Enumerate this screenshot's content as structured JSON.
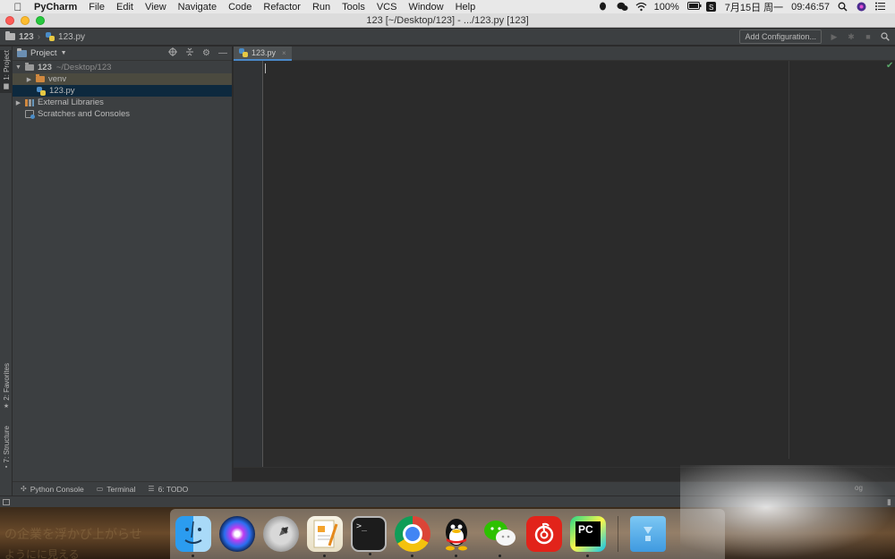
{
  "menubar": {
    "app_name": "PyCharm",
    "items": [
      "File",
      "Edit",
      "View",
      "Navigate",
      "Code",
      "Refactor",
      "Run",
      "Tools",
      "VCS",
      "Window",
      "Help"
    ],
    "battery": "100%",
    "date": "7月15日 周一",
    "time": "09:46:57"
  },
  "window": {
    "title": "123 [~/Desktop/123] - .../123.py [123]"
  },
  "navbar": {
    "project_crumb": "123",
    "file_crumb": "123.py",
    "add_config": "Add Configuration..."
  },
  "left_strip": {
    "project_tab": "1: Project",
    "favorites_tab": "2: Favorites",
    "structure_tab": "7: Structure"
  },
  "project_panel": {
    "title": "Project",
    "tree": {
      "root_name": "123",
      "root_path": "~/Desktop/123",
      "venv": "venv",
      "file": "123.py",
      "external": "External Libraries",
      "scratches": "Scratches and Consoles"
    }
  },
  "editor": {
    "tab_label": "123.py"
  },
  "bottom_tools": {
    "python_console": "Python Console",
    "terminal": "Terminal",
    "todo": "6: TODO",
    "event_log": "og"
  },
  "desktop": {
    "text_line1": "の企業を浮かび上がらせ",
    "text_line2": "ようにに見える"
  },
  "dock": {
    "terminal_prompt": ">_",
    "pycharm_label": "PC"
  },
  "colors": {
    "accent": "#4a88c7",
    "selection": "#0d293e",
    "folder": "#d0883f",
    "check": "#59a869"
  }
}
